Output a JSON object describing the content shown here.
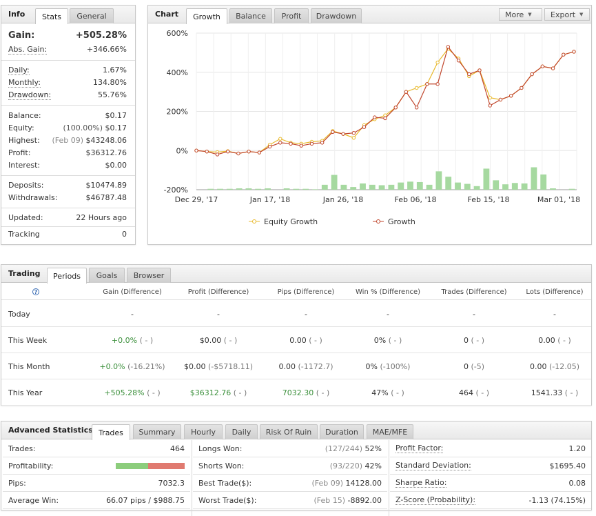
{
  "info": {
    "title": "Info",
    "tabs": [
      "Stats",
      "General"
    ],
    "gain_label": "Gain:",
    "gain_value": "+505.28%",
    "abs_gain_label": "Abs. Gain:",
    "abs_gain_value": "+346.66%",
    "daily_label": "Daily:",
    "daily_value": "1.67%",
    "monthly_label": "Monthly:",
    "monthly_value": "134.80%",
    "drawdown_label": "Drawdown:",
    "drawdown_value": "55.76%",
    "balance_label": "Balance:",
    "balance_value": "$0.17",
    "equity_label": "Equity:",
    "equity_note": "(100.00%)",
    "equity_value": "$0.17",
    "highest_label": "Highest:",
    "highest_note": "(Feb 09)",
    "highest_value": "$43248.06",
    "profit_label": "Profit:",
    "profit_value": "$36312.76",
    "interest_label": "Interest:",
    "interest_value": "$0.00",
    "deposits_label": "Deposits:",
    "deposits_value": "$10474.89",
    "withdrawals_label": "Withdrawals:",
    "withdrawals_value": "$46787.48",
    "updated_label": "Updated:",
    "updated_value": "22 Hours ago",
    "tracking_label": "Tracking",
    "tracking_value": "0"
  },
  "chart_panel": {
    "title": "Chart",
    "tabs": [
      "Growth",
      "Balance",
      "Profit",
      "Drawdown"
    ],
    "more_label": "More",
    "export_label": "Export"
  },
  "chart_data": {
    "type": "line",
    "title": "",
    "y_ticks": [
      "600%",
      "400%",
      "200%",
      "0%",
      "-200%"
    ],
    "x_ticks": [
      "Dec 29, '17",
      "Jan 17, '18",
      "Jan 26, '18",
      "Feb 06, '18",
      "Feb 15, '18",
      "Mar 01, '18"
    ],
    "ylim": [
      -200,
      600
    ],
    "legend_position": "bottom",
    "colors": {
      "equity": "#e8b92c",
      "growth": "#c0452b",
      "bars": "#a6d9a0",
      "grid": "#e6e6e6"
    },
    "series": [
      {
        "name": "Equity Growth",
        "values": [
          0,
          -5,
          -8,
          -3,
          -15,
          -5,
          -10,
          30,
          60,
          40,
          35,
          45,
          50,
          100,
          85,
          65,
          130,
          160,
          180,
          220,
          300,
          320,
          340,
          450,
          520,
          470,
          380,
          410,
          270,
          260,
          280,
          320,
          390,
          430,
          420,
          490,
          505
        ]
      },
      {
        "name": "Growth",
        "values": [
          0,
          -5,
          -20,
          -5,
          -15,
          -5,
          -10,
          20,
          40,
          35,
          25,
          35,
          40,
          95,
          85,
          90,
          120,
          170,
          165,
          220,
          300,
          220,
          340,
          340,
          530,
          460,
          390,
          410,
          230,
          260,
          280,
          320,
          390,
          430,
          420,
          490,
          505
        ]
      }
    ],
    "bar_values": [
      0,
      2,
      2,
      2,
      3,
      3,
      2,
      3,
      0,
      3,
      2,
      2,
      1,
      11,
      33,
      11,
      6,
      14,
      11,
      10,
      11,
      16,
      18,
      17,
      11,
      41,
      29,
      16,
      13,
      8,
      47,
      21,
      12,
      15,
      14,
      50,
      34,
      3,
      0,
      2
    ]
  },
  "trading": {
    "title": "Trading",
    "tabs": [
      "Periods",
      "Goals",
      "Browser"
    ],
    "help_icon": "?",
    "columns": [
      "Gain (Difference)",
      "Profit (Difference)",
      "Pips (Difference)",
      "Win % (Difference)",
      "Trades (Difference)",
      "Lots (Difference)"
    ],
    "rows": [
      {
        "period": "Today",
        "gain": "-",
        "gain_diff": "",
        "profit": "-",
        "profit_diff": "",
        "pips": "-",
        "pips_diff": "",
        "win": "-",
        "win_diff": "",
        "trades": "-",
        "trades_diff": "",
        "lots": "-",
        "lots_diff": ""
      },
      {
        "period": "This Week",
        "gain": "+0.0%",
        "gain_diff": "( - )",
        "profit": "$0.00",
        "profit_diff": "( - )",
        "pips": "0.00",
        "pips_diff": "( - )",
        "win": "0%",
        "win_diff": "( - )",
        "trades": "0",
        "trades_diff": "( - )",
        "lots": "0.00",
        "lots_diff": "( - )"
      },
      {
        "period": "This Month",
        "gain": "+0.0%",
        "gain_diff": "(-16.21%)",
        "profit": "$0.00",
        "profit_diff": "(-$5718.11)",
        "pips": "0.00",
        "pips_diff": "(-1172.7)",
        "win": "0%",
        "win_diff": "(-100%)",
        "trades": "0",
        "trades_diff": "(-5)",
        "lots": "0.00",
        "lots_diff": "(-12.05)"
      },
      {
        "period": "This Year",
        "gain": "+505.28%",
        "gain_diff": "( - )",
        "profit": "$36312.76",
        "profit_diff": "( - )",
        "pips": "7032.30",
        "pips_diff": "( - )",
        "win": "47%",
        "win_diff": "( - )",
        "trades": "464",
        "trades_diff": "( - )",
        "lots": "1541.33",
        "lots_diff": "( - )"
      }
    ]
  },
  "advanced": {
    "title": "Advanced Statistics",
    "tabs": [
      "Trades",
      "Summary",
      "Hourly",
      "Daily",
      "Risk Of Ruin",
      "Duration",
      "MAE/MFE"
    ],
    "col1": [
      {
        "label": "Trades:",
        "value": "464"
      },
      {
        "label": "Profitability:",
        "value": ""
      },
      {
        "label": "Pips:",
        "value": "7032.3"
      },
      {
        "label": "Average Win:",
        "value": "66.07 pips / $988.75"
      }
    ],
    "profitability_win_fraction": 0.47,
    "col2": [
      {
        "label": "Longs Won:",
        "note": "(127/244)",
        "value": "52%"
      },
      {
        "label": "Shorts Won:",
        "note": "(93/220)",
        "value": "42%"
      },
      {
        "label": "Best Trade($):",
        "note": "(Feb 09)",
        "value": "14128.00"
      },
      {
        "label": "Worst Trade($):",
        "note": "(Feb 15)",
        "value": "-8892.00"
      }
    ],
    "col3": [
      {
        "label": "Profit Factor:",
        "value": "1.20"
      },
      {
        "label": "Standard Deviation:",
        "value": "$1695.40"
      },
      {
        "label": "Sharpe Ratio:",
        "value": "0.08"
      },
      {
        "label": "Z-Score (Probability):",
        "value": "-1.13 (74.15%)"
      }
    ]
  }
}
